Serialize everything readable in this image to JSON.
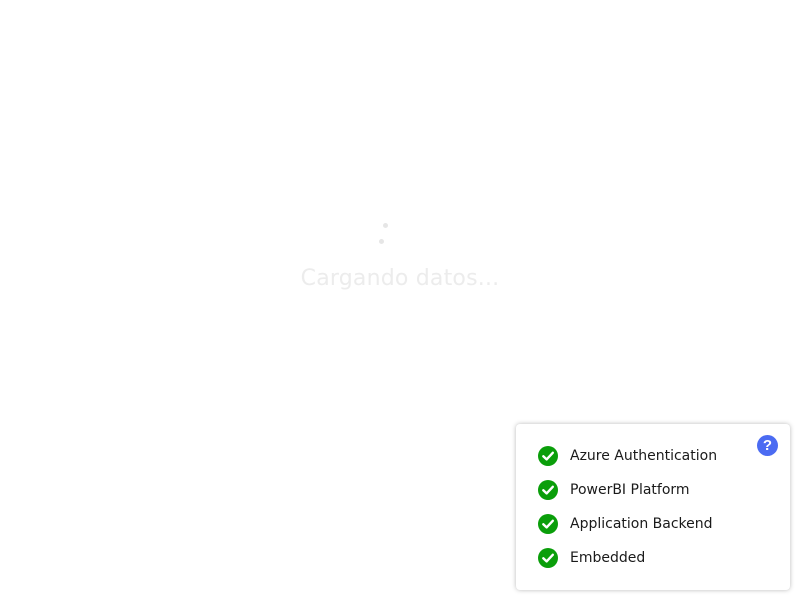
{
  "loading": {
    "text": "Cargando datos..."
  },
  "status_panel": {
    "help_icon": "question-mark",
    "help_label": "?",
    "check_color": "#0a9e0a",
    "help_color": "#4b6bf2",
    "items": [
      {
        "label": "Azure Authentication",
        "status": "ok",
        "icon": "check-circle-icon"
      },
      {
        "label": "PowerBI Platform",
        "status": "ok",
        "icon": "check-circle-icon"
      },
      {
        "label": "Application Backend",
        "status": "ok",
        "icon": "check-circle-icon"
      },
      {
        "label": "Embedded",
        "status": "ok",
        "icon": "check-circle-icon"
      }
    ]
  }
}
